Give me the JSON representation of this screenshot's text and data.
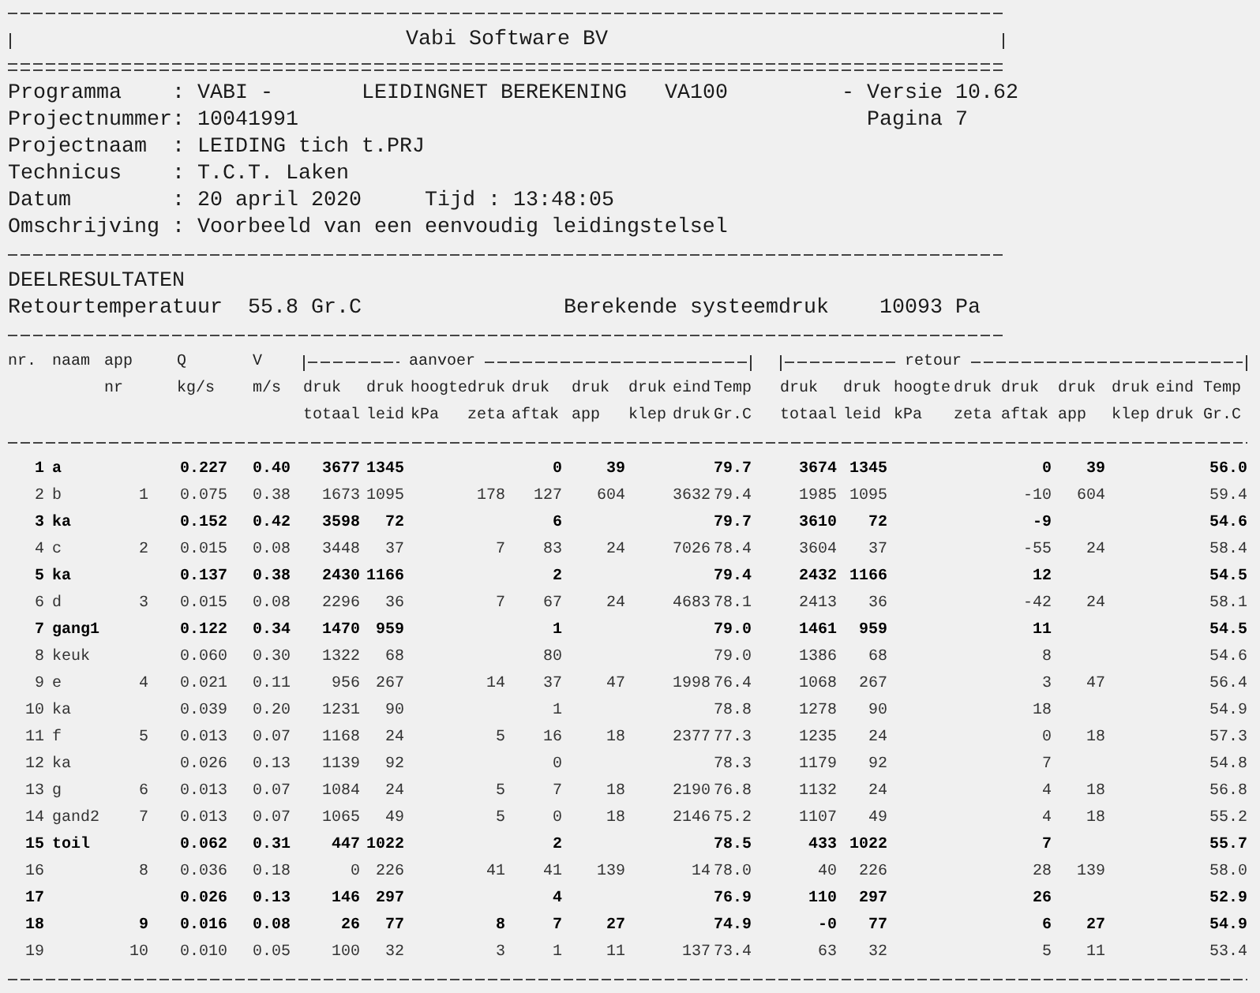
{
  "banner": {
    "title": "Vabi Software BV"
  },
  "info_lines": [
    {
      "label": "Programma",
      "sep": ":",
      "value": "VABI -",
      "title": "LEIDINGNET BEREKENING",
      "code": "VA100",
      "aside": {
        "label": "- Versie",
        "value": "10.62"
      }
    },
    {
      "label": "Projectnummer",
      "sep": ":",
      "value": "10041991",
      "aside": {
        "label": "Pagina",
        "value": "7"
      }
    },
    {
      "label": "Projectnaam",
      "sep": ":",
      "value": "LEIDING tich t.PRJ"
    },
    {
      "label": "Technicus",
      "sep": ":",
      "value": "T.C.T. Laken"
    },
    {
      "label": "Datum",
      "sep": ":",
      "value": "20 april 2020",
      "time": {
        "label": "Tijd",
        "sep": ":",
        "value": "13:48:05"
      }
    },
    {
      "label": "Omschrijving",
      "sep": ":",
      "value": "Voorbeeld van een eenvoudig leidingstelsel"
    }
  ],
  "section_title": "DEELRESULTATEN",
  "summary": [
    {
      "label": "Retourtemperatuur",
      "value": "55.8 Gr.C"
    },
    {
      "label": "Berekende systeemdruk",
      "value": "10093 Pa"
    }
  ],
  "table": {
    "columns": [
      {
        "heading": [
          "nr."
        ]
      },
      {
        "heading": [
          "naam"
        ]
      },
      {
        "heading": [
          "app",
          "nr"
        ]
      },
      {
        "heading": [
          "Q",
          "kg/s"
        ]
      },
      {
        "heading": [
          "V",
          "m/s"
        ]
      }
    ],
    "column_groups": [
      {
        "label": "aanvoer",
        "columns": [
          {
            "heading": [
              "druk",
              "totaal"
            ]
          },
          {
            "heading": [
              "druk",
              "leid"
            ]
          },
          {
            "heading": [
              "hoogte",
              "kPa"
            ]
          },
          {
            "heading": [
              "druk",
              "zeta"
            ]
          },
          {
            "heading": [
              "druk",
              "aftak"
            ]
          },
          {
            "heading": [
              "druk",
              "app"
            ]
          },
          {
            "heading": [
              "druk",
              "klep"
            ]
          },
          {
            "heading": [
              "eind",
              "druk"
            ]
          },
          {
            "heading": [
              "Temp",
              "Gr.C"
            ]
          }
        ]
      },
      {
        "label": "retour",
        "columns": [
          {
            "heading": [
              "druk",
              "totaal"
            ]
          },
          {
            "heading": [
              "druk",
              "leid"
            ]
          },
          {
            "heading": [
              "hoogte",
              "kPa"
            ]
          },
          {
            "heading": [
              "druk",
              "zeta"
            ]
          },
          {
            "heading": [
              "druk",
              "aftak"
            ]
          },
          {
            "heading": [
              "druk",
              "app"
            ]
          },
          {
            "heading": [
              "druk",
              "klep"
            ]
          },
          {
            "heading": [
              "eind",
              "druk"
            ]
          },
          {
            "heading": [
              "Temp",
              "Gr.C"
            ]
          }
        ]
      }
    ],
    "rows": [
      {
        "bold": true,
        "cells": [
          "1",
          "a",
          null,
          "0.227",
          "0.40",
          "3677",
          "1345",
          null,
          null,
          "0",
          "39",
          null,
          null,
          "79.7",
          "3674",
          "1345",
          null,
          null,
          "0",
          "39",
          null,
          null,
          "56.0"
        ]
      },
      {
        "bold": false,
        "cells": [
          "2",
          "b",
          "1",
          "0.075",
          "0.38",
          "1673",
          "1095",
          null,
          "178",
          "127",
          "604",
          null,
          "3632",
          "79.4",
          "1985",
          "1095",
          null,
          null,
          "-10",
          "604",
          null,
          null,
          "59.4"
        ]
      },
      {
        "bold": true,
        "cells": [
          "3",
          "ka",
          null,
          "0.152",
          "0.42",
          "3598",
          "72",
          null,
          null,
          "6",
          null,
          null,
          null,
          "79.7",
          "3610",
          "72",
          null,
          null,
          "-9",
          null,
          null,
          null,
          "54.6"
        ]
      },
      {
        "bold": false,
        "cells": [
          "4",
          "c",
          "2",
          "0.015",
          "0.08",
          "3448",
          "37",
          null,
          "7",
          "83",
          "24",
          null,
          "7026",
          "78.4",
          "3604",
          "37",
          null,
          null,
          "-55",
          "24",
          null,
          null,
          "58.4"
        ]
      },
      {
        "bold": true,
        "cells": [
          "5",
          "ka",
          null,
          "0.137",
          "0.38",
          "2430",
          "1166",
          null,
          null,
          "2",
          null,
          null,
          null,
          "79.4",
          "2432",
          "1166",
          null,
          null,
          "12",
          null,
          null,
          null,
          "54.5"
        ]
      },
      {
        "bold": false,
        "cells": [
          "6",
          "d",
          "3",
          "0.015",
          "0.08",
          "2296",
          "36",
          null,
          "7",
          "67",
          "24",
          null,
          "4683",
          "78.1",
          "2413",
          "36",
          null,
          null,
          "-42",
          "24",
          null,
          null,
          "58.1"
        ]
      },
      {
        "bold": true,
        "cells": [
          "7",
          "gang1",
          null,
          "0.122",
          "0.34",
          "1470",
          "959",
          null,
          null,
          "1",
          null,
          null,
          null,
          "79.0",
          "1461",
          "959",
          null,
          null,
          "11",
          null,
          null,
          null,
          "54.5"
        ]
      },
      {
        "bold": false,
        "cells": [
          "8",
          "keuk",
          null,
          "0.060",
          "0.30",
          "1322",
          "68",
          null,
          null,
          "80",
          null,
          null,
          null,
          "79.0",
          "1386",
          "68",
          null,
          null,
          "8",
          null,
          null,
          null,
          "54.6"
        ]
      },
      {
        "bold": false,
        "cells": [
          "9",
          "e",
          "4",
          "0.021",
          "0.11",
          "956",
          "267",
          null,
          "14",
          "37",
          "47",
          null,
          "1998",
          "76.4",
          "1068",
          "267",
          null,
          null,
          "3",
          "47",
          null,
          null,
          "56.4"
        ]
      },
      {
        "bold": false,
        "cells": [
          "10",
          "ka",
          null,
          "0.039",
          "0.20",
          "1231",
          "90",
          null,
          null,
          "1",
          null,
          null,
          null,
          "78.8",
          "1278",
          "90",
          null,
          null,
          "18",
          null,
          null,
          null,
          "54.9"
        ]
      },
      {
        "bold": false,
        "cells": [
          "11",
          "f",
          "5",
          "0.013",
          "0.07",
          "1168",
          "24",
          null,
          "5",
          "16",
          "18",
          null,
          "2377",
          "77.3",
          "1235",
          "24",
          null,
          null,
          "0",
          "18",
          null,
          null,
          "57.3"
        ]
      },
      {
        "bold": false,
        "cells": [
          "12",
          "ka",
          null,
          "0.026",
          "0.13",
          "1139",
          "92",
          null,
          null,
          "0",
          null,
          null,
          null,
          "78.3",
          "1179",
          "92",
          null,
          null,
          "7",
          null,
          null,
          null,
          "54.8"
        ]
      },
      {
        "bold": false,
        "cells": [
          "13",
          "g",
          "6",
          "0.013",
          "0.07",
          "1084",
          "24",
          null,
          "5",
          "7",
          "18",
          null,
          "2190",
          "76.8",
          "1132",
          "24",
          null,
          null,
          "4",
          "18",
          null,
          null,
          "56.8"
        ]
      },
      {
        "bold": false,
        "cells": [
          "14",
          "gand2",
          "7",
          "0.013",
          "0.07",
          "1065",
          "49",
          null,
          "5",
          "0",
          "18",
          null,
          "2146",
          "75.2",
          "1107",
          "49",
          null,
          null,
          "4",
          "18",
          null,
          null,
          "55.2"
        ]
      },
      {
        "bold": true,
        "cells": [
          "15",
          "toil",
          null,
          "0.062",
          "0.31",
          "447",
          "1022",
          null,
          null,
          "2",
          null,
          null,
          null,
          "78.5",
          "433",
          "1022",
          null,
          null,
          "7",
          null,
          null,
          null,
          "55.7"
        ]
      },
      {
        "bold": false,
        "cells": [
          "16",
          null,
          "8",
          "0.036",
          "0.18",
          "0",
          "226",
          null,
          "41",
          "41",
          "139",
          null,
          "14",
          "78.0",
          "40",
          "226",
          null,
          null,
          "28",
          "139",
          null,
          null,
          "58.0"
        ]
      },
      {
        "bold": true,
        "cells": [
          "17",
          null,
          null,
          "0.026",
          "0.13",
          "146",
          "297",
          null,
          null,
          "4",
          null,
          null,
          null,
          "76.9",
          "110",
          "297",
          null,
          null,
          "26",
          null,
          null,
          null,
          "52.9"
        ]
      },
      {
        "bold": true,
        "cells": [
          "18",
          null,
          "9",
          "0.016",
          "0.08",
          "26",
          "77",
          null,
          "8",
          "7",
          "27",
          null,
          null,
          "74.9",
          "-0",
          "77",
          null,
          null,
          "6",
          "27",
          null,
          null,
          "54.9"
        ]
      },
      {
        "bold": false,
        "cells": [
          "19",
          null,
          "10",
          "0.010",
          "0.05",
          "100",
          "32",
          null,
          "3",
          "1",
          "11",
          null,
          "137",
          "73.4",
          "63",
          "32",
          null,
          null,
          "5",
          "11",
          null,
          null,
          "53.4"
        ]
      }
    ]
  }
}
